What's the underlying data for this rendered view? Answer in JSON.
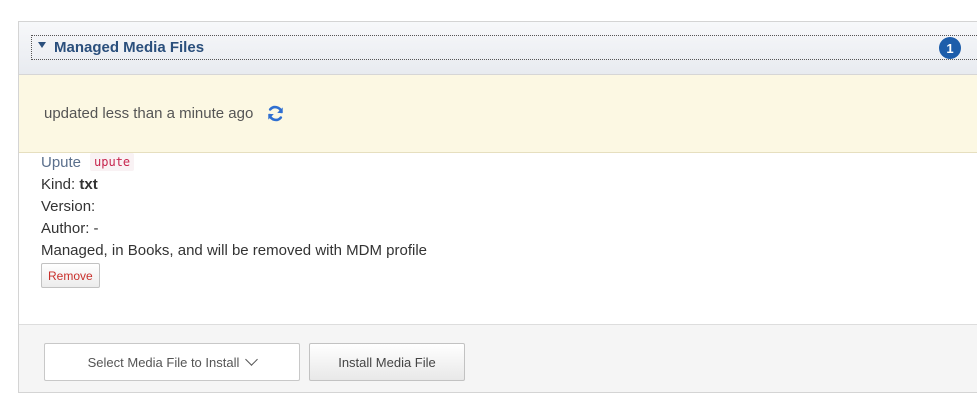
{
  "panel": {
    "title": "Managed Media Files",
    "count": "1"
  },
  "status": {
    "text": "updated less than a minute ago"
  },
  "file": {
    "name": "Upute",
    "id": "upute",
    "kind_label": "Kind: ",
    "kind_value": "txt",
    "version_label": "Version:",
    "author_label": "Author: -",
    "state_text": "Managed, in Books, and will be removed with MDM profile",
    "remove_label": "Remove"
  },
  "footer": {
    "select_label": "Select Media File to Install",
    "install_label": "Install Media File"
  },
  "colors": {
    "title": "#2a4f7c",
    "badge": "#1d5daa",
    "status_bg": "#fcf8e3",
    "file_id": "#c7254e",
    "remove_text": "#c9302c"
  }
}
